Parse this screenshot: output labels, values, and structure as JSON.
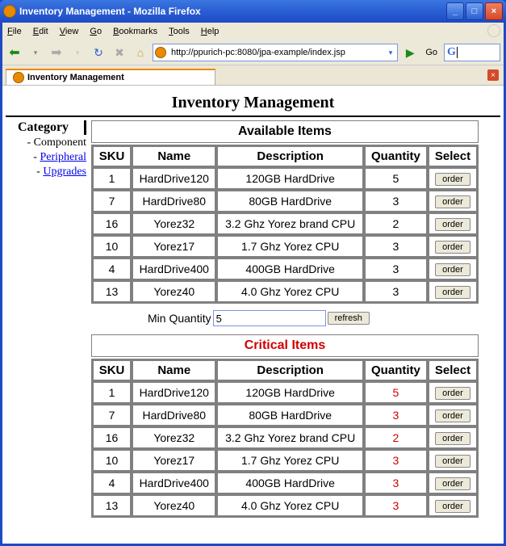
{
  "window": {
    "title": "Inventory Management - Mozilla Firefox"
  },
  "menu": {
    "file": "File",
    "edit": "Edit",
    "view": "View",
    "go": "Go",
    "bookmarks": "Bookmarks",
    "tools": "Tools",
    "help": "Help"
  },
  "nav": {
    "url": "http://ppurich-pc:8080/jpa-example/index.jsp",
    "go_label": "Go"
  },
  "tab": {
    "label": "Inventory Management"
  },
  "page": {
    "title": "Inventory Management"
  },
  "sidebar": {
    "header": "Category",
    "items": [
      {
        "label": "Component",
        "link": false,
        "prefix": "- "
      },
      {
        "label": "Peripheral",
        "link": true,
        "prefix": "- "
      },
      {
        "label": "Upgrades",
        "link": true,
        "prefix": "- "
      }
    ]
  },
  "available": {
    "caption": "Available Items",
    "headers": {
      "sku": "SKU",
      "name": "Name",
      "desc": "Description",
      "qty": "Quantity",
      "select": "Select"
    },
    "order_label": "order",
    "rows": [
      {
        "sku": "1",
        "name": "HardDrive120",
        "desc": "120GB HardDrive",
        "qty": "5"
      },
      {
        "sku": "7",
        "name": "HardDrive80",
        "desc": "80GB HardDrive",
        "qty": "3"
      },
      {
        "sku": "16",
        "name": "Yorez32",
        "desc": "3.2 Ghz Yorez brand CPU",
        "qty": "2"
      },
      {
        "sku": "10",
        "name": "Yorez17",
        "desc": "1.7 Ghz Yorez CPU",
        "qty": "3"
      },
      {
        "sku": "4",
        "name": "HardDrive400",
        "desc": "400GB HardDrive",
        "qty": "3"
      },
      {
        "sku": "13",
        "name": "Yorez40",
        "desc": "4.0 Ghz Yorez CPU",
        "qty": "3"
      }
    ]
  },
  "filter": {
    "label": "Min Quantity",
    "value": "5",
    "refresh_label": "refresh"
  },
  "critical": {
    "caption": "Critical Items",
    "headers": {
      "sku": "SKU",
      "name": "Name",
      "desc": "Description",
      "qty": "Quantity",
      "select": "Select"
    },
    "order_label": "order",
    "rows": [
      {
        "sku": "1",
        "name": "HardDrive120",
        "desc": "120GB HardDrive",
        "qty": "5"
      },
      {
        "sku": "7",
        "name": "HardDrive80",
        "desc": "80GB HardDrive",
        "qty": "3"
      },
      {
        "sku": "16",
        "name": "Yorez32",
        "desc": "3.2 Ghz Yorez brand CPU",
        "qty": "2"
      },
      {
        "sku": "10",
        "name": "Yorez17",
        "desc": "1.7 Ghz Yorez CPU",
        "qty": "3"
      },
      {
        "sku": "4",
        "name": "HardDrive400",
        "desc": "400GB HardDrive",
        "qty": "3"
      },
      {
        "sku": "13",
        "name": "Yorez40",
        "desc": "4.0 Ghz Yorez CPU",
        "qty": "3"
      }
    ]
  }
}
